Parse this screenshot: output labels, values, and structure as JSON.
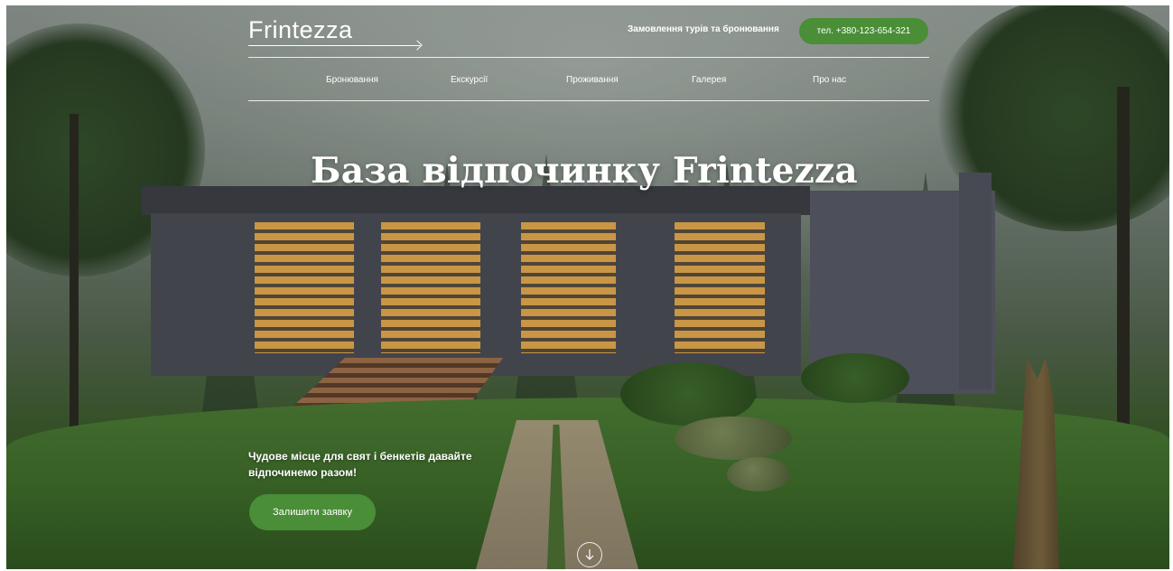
{
  "header": {
    "logo": "Frintezza",
    "order_link": "Замовлення турів та бронювання",
    "phone_button": "тел. +380-123-654-321"
  },
  "nav": {
    "items": [
      {
        "label": "Бронювання"
      },
      {
        "label": "Екскурсії"
      },
      {
        "label": "Проживання"
      },
      {
        "label": "Галерея"
      },
      {
        "label": "Про нас"
      }
    ]
  },
  "hero": {
    "title": "База відпочинку Frintezza",
    "tagline": "Чудове місце для свят і бенкетів  давайте відпочинемо разом!",
    "cta": "Залишити заявку"
  },
  "icons": {
    "logo_arrow": "arrow-right-icon",
    "scroll": "arrow-down-circle-icon"
  },
  "colors": {
    "accent": "#4a8e37"
  }
}
